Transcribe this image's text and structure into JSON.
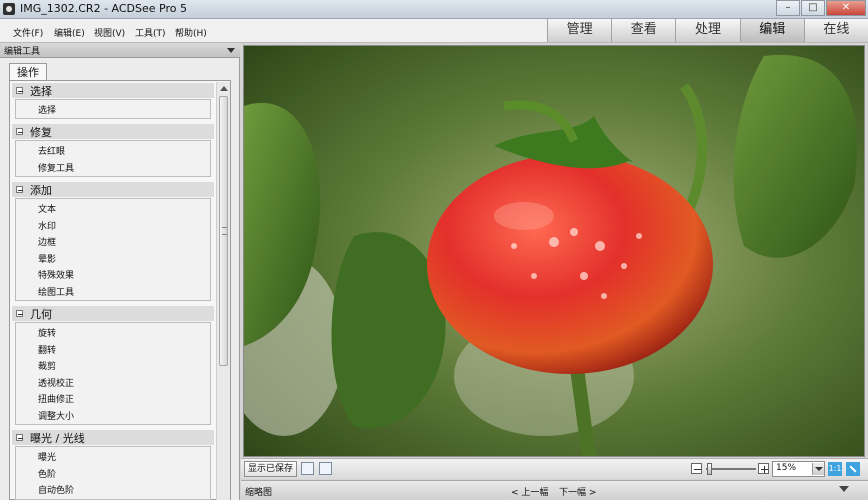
{
  "window": {
    "title": "IMG_1302.CR2 - ACDSee Pro 5",
    "buttons": [
      "–",
      "□",
      "✕"
    ]
  },
  "menu": [
    "文件(F)",
    "编辑(E)",
    "视图(V)",
    "工具(T)",
    "帮助(H)"
  ],
  "modes": [
    {
      "label": "管理",
      "active": false
    },
    {
      "label": "查看",
      "active": false
    },
    {
      "label": "处理",
      "active": false
    },
    {
      "label": "编辑",
      "active": true
    },
    {
      "label": "在线",
      "active": false
    }
  ],
  "panel": {
    "title": "编辑工具",
    "tab": "操作",
    "sections": [
      {
        "title": "选择",
        "items": [
          "选择"
        ]
      },
      {
        "title": "修复",
        "items": [
          "去红眼",
          "修复工具"
        ]
      },
      {
        "title": "添加",
        "items": [
          "文本",
          "水印",
          "边框",
          "晕影",
          "特殊效果",
          "绘图工具"
        ]
      },
      {
        "title": "几何",
        "items": [
          "旋转",
          "翻转",
          "裁剪",
          "透视校正",
          "扭曲修正",
          "调整大小"
        ]
      },
      {
        "title": "曝光 / 光线",
        "items": [
          "曝光",
          "色阶",
          "自动色阶"
        ]
      }
    ]
  },
  "toolbar": {
    "save_label": "显示已保存",
    "zoom_value": "15%",
    "fit_label": "1:1"
  },
  "status": {
    "thumbnails_label": "缩略图",
    "prev_label": "< 上一幅",
    "next_label": "下一幅 >"
  },
  "icons": {
    "app": "acdsee-eye-icon",
    "zoom_out": "minus-icon",
    "zoom_in": "plus-icon",
    "fullscreen": "diagonal-arrow-icon"
  },
  "colors": {
    "accent": "#3fa3e0",
    "tomato_red": "#e2302c",
    "leaf_green": "#4f7a2b"
  }
}
